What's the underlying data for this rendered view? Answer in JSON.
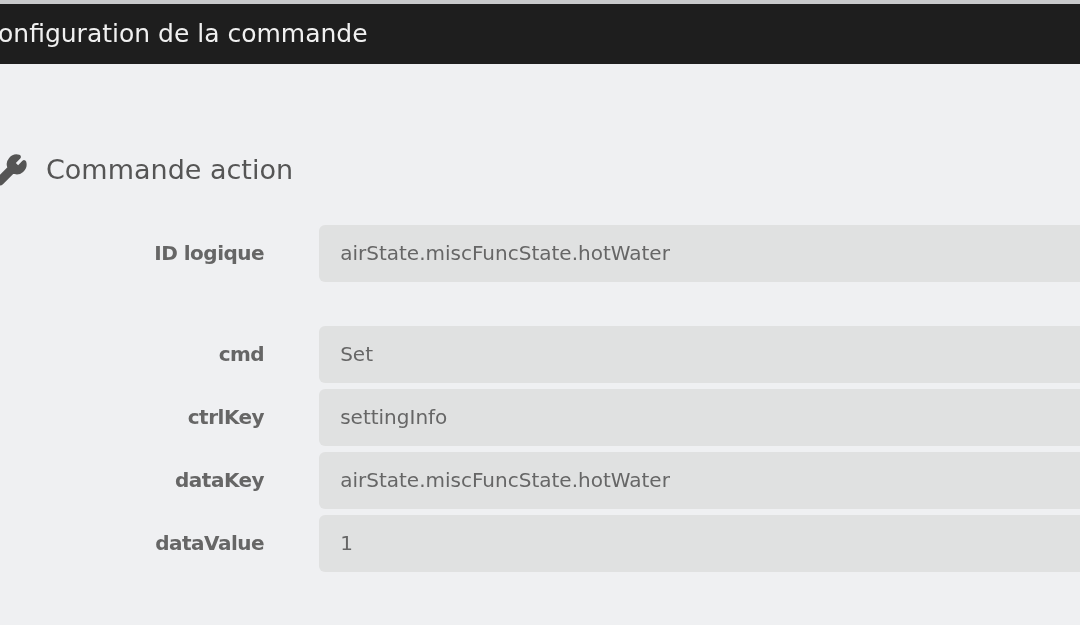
{
  "dialog": {
    "title": "onfiguration de la commande"
  },
  "section": {
    "title": "Commande action"
  },
  "logical_id": {
    "label": "ID logique",
    "value": "airState.miscFuncState.hotWater"
  },
  "parameters": [
    {
      "label": "cmd",
      "value": "Set"
    },
    {
      "label": "ctrlKey",
      "value": "settingInfo"
    },
    {
      "label": "dataKey",
      "value": "airState.miscFuncState.hotWater"
    },
    {
      "label": "dataValue",
      "value": "1"
    }
  ]
}
